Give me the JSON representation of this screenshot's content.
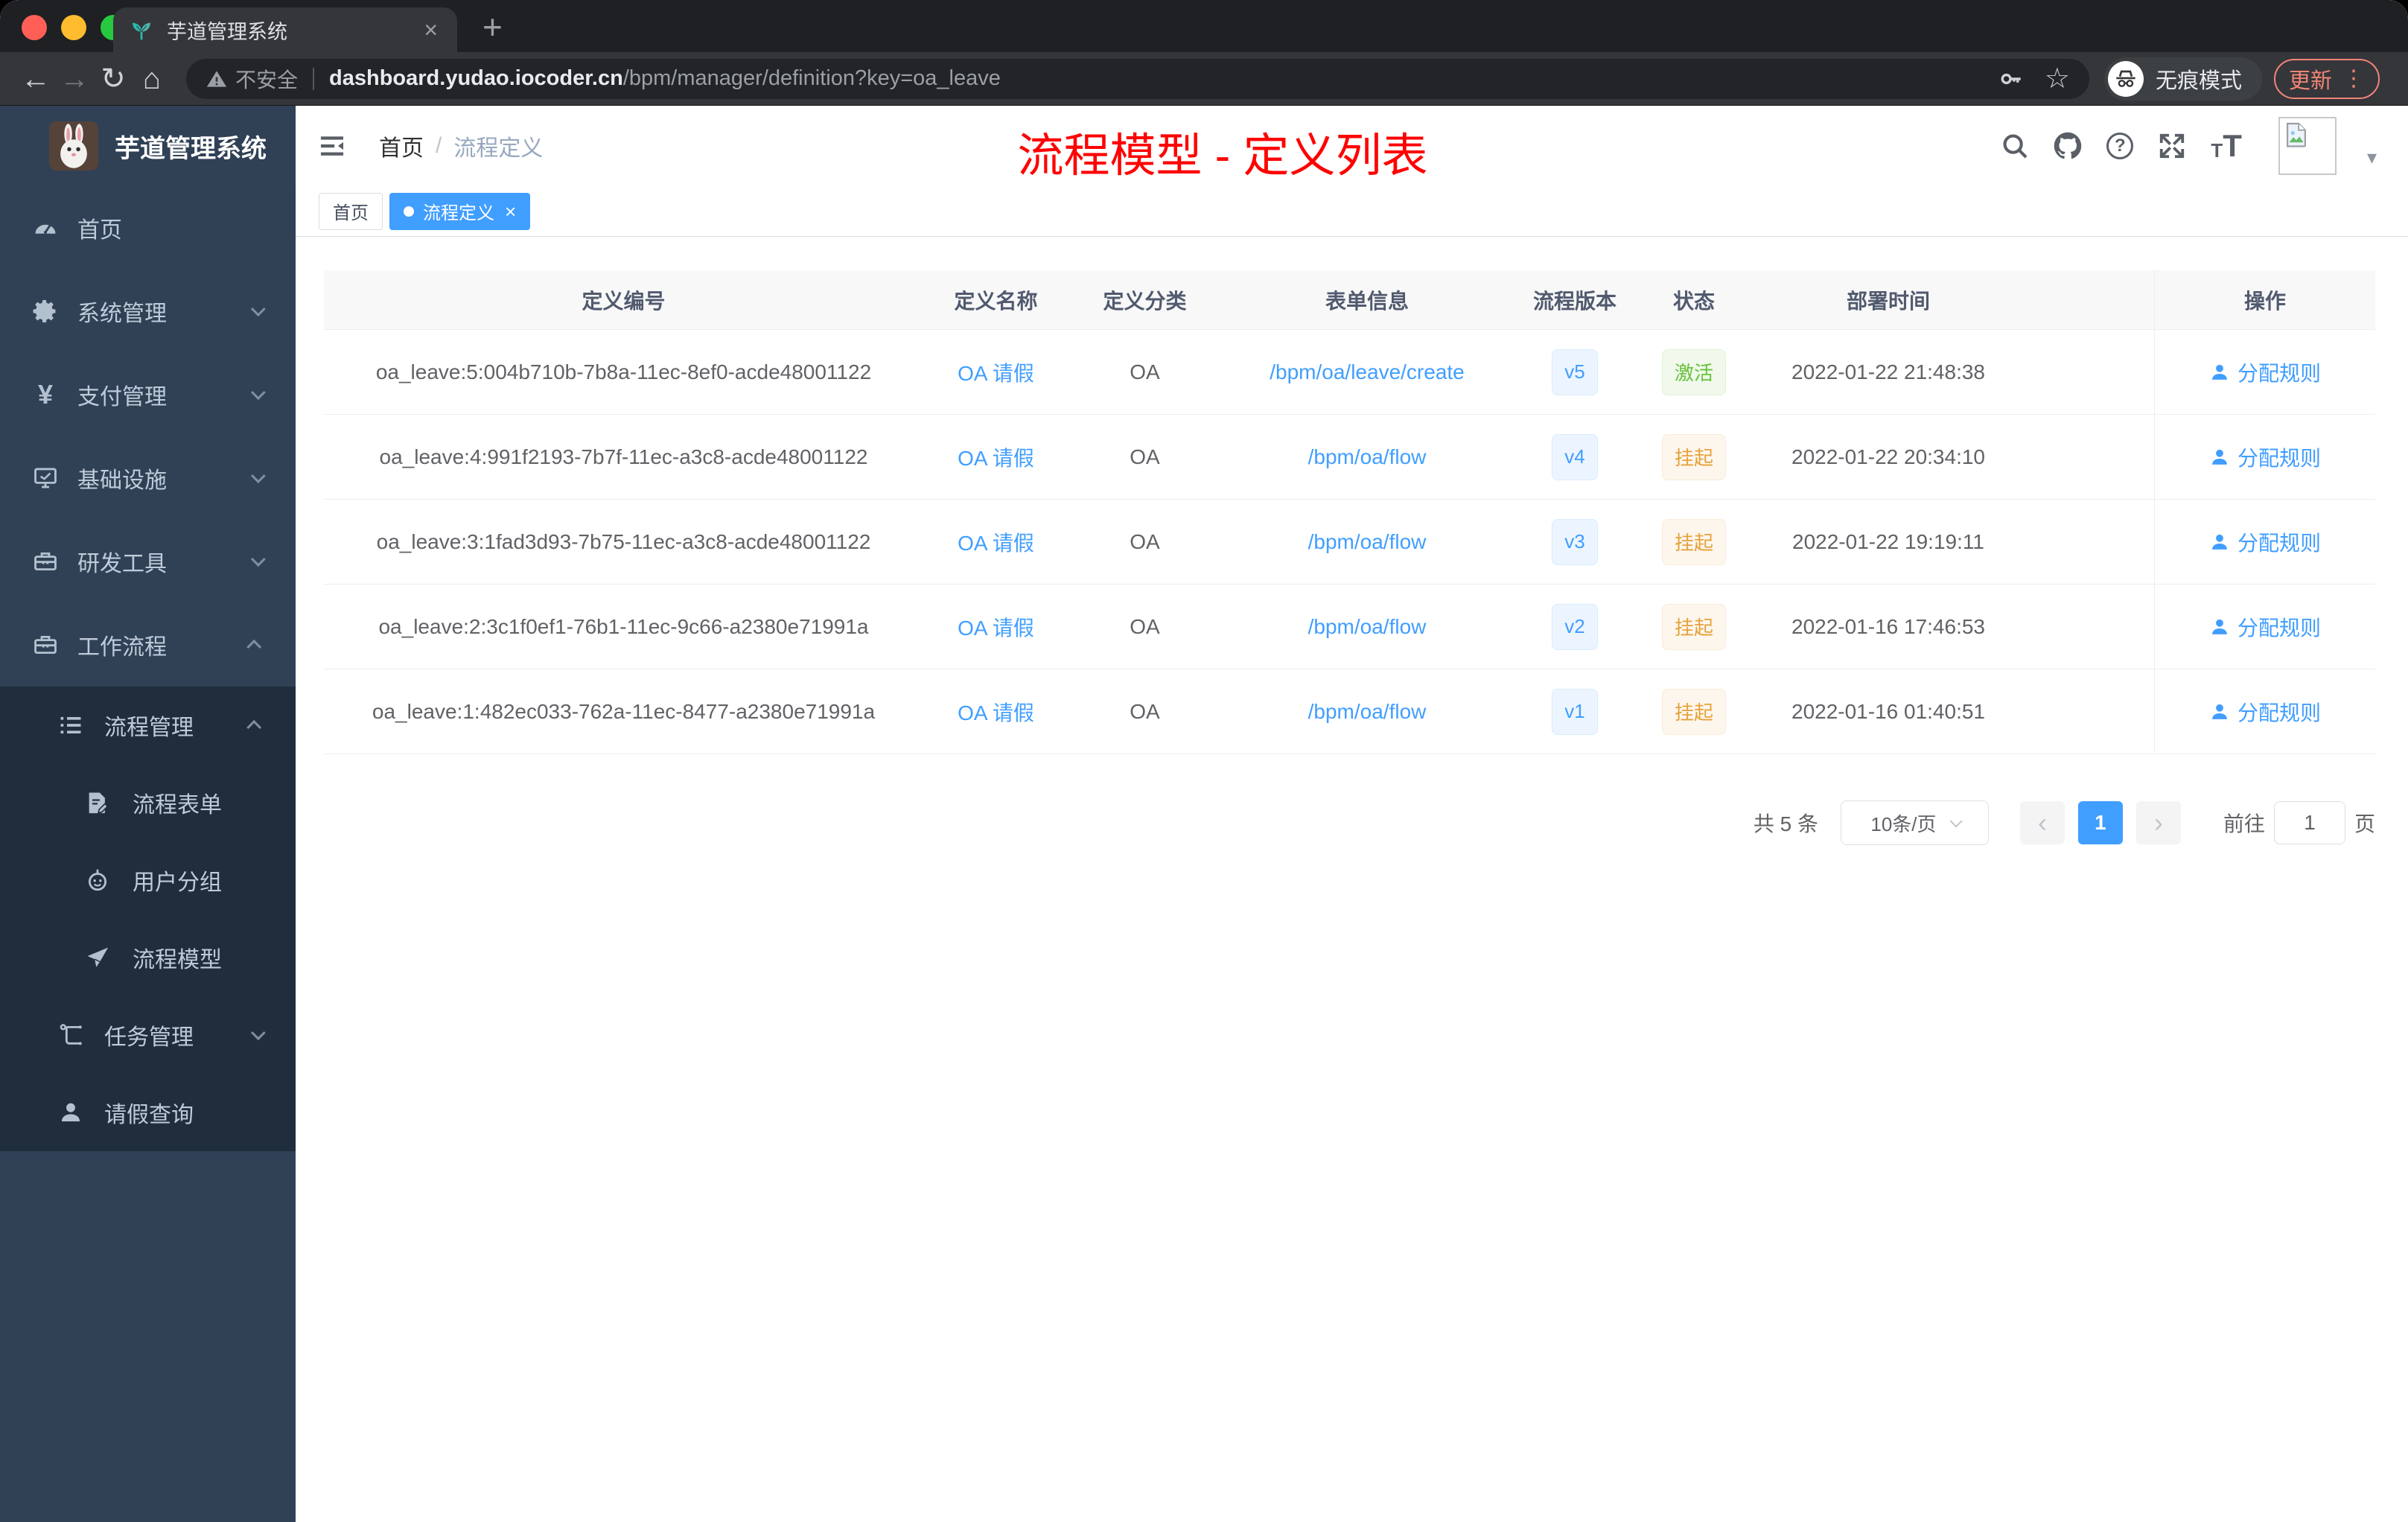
{
  "browser": {
    "tab_title": "芋道管理系统",
    "tab_close": "×",
    "new_tab": "+",
    "back": "←",
    "forward": "→",
    "reload": "↻",
    "home": "⌂",
    "security_label": "不安全",
    "url_host": "dashboard.yudao.iocoder.cn",
    "url_path": "/bpm/manager/definition?key=oa_leave",
    "star": "☆",
    "incognito_label": "无痕模式",
    "update_label": "更新",
    "menu_dots": "⋮"
  },
  "sidebar": {
    "logo_title": "芋道管理系统",
    "items": {
      "home": "首页",
      "system": "系统管理",
      "payment": "支付管理",
      "infra": "基础设施",
      "devtools": "研发工具",
      "workflow": "工作流程",
      "process_mgmt": "流程管理",
      "process_form": "流程表单",
      "user_group": "用户分组",
      "process_model": "流程模型",
      "task_mgmt": "任务管理",
      "leave_query": "请假查询"
    },
    "yen_glyph": "¥"
  },
  "navbar": {
    "breadcrumb_home": "首页",
    "breadcrumb_sep": "/",
    "breadcrumb_current": "流程定义",
    "annotation": "流程模型 - 定义列表",
    "help_glyph": "?",
    "text_size_small": "T",
    "text_size_large": "T",
    "avatar_caret": "▾"
  },
  "tags": {
    "home": "首页",
    "active": "流程定义",
    "close": "×"
  },
  "table": {
    "columns": {
      "id": "定义编号",
      "name": "定义名称",
      "category": "定义分类",
      "form": "表单信息",
      "version": "流程版本",
      "status": "状态",
      "time": "部署时间",
      "action": "操作"
    },
    "rows": [
      {
        "id": "oa_leave:5:004b710b-7b8a-11ec-8ef0-acde48001122",
        "name": "OA 请假",
        "category": "OA",
        "form": "/bpm/oa/leave/create",
        "version": "v5",
        "status": "激活",
        "time": "2022-01-22 21:48:38",
        "action": "分配规则"
      },
      {
        "id": "oa_leave:4:991f2193-7b7f-11ec-a3c8-acde48001122",
        "name": "OA 请假",
        "category": "OA",
        "form": "/bpm/oa/flow",
        "version": "v4",
        "status": "挂起",
        "time": "2022-01-22 20:34:10",
        "action": "分配规则"
      },
      {
        "id": "oa_leave:3:1fad3d93-7b75-11ec-a3c8-acde48001122",
        "name": "OA 请假",
        "category": "OA",
        "form": "/bpm/oa/flow",
        "version": "v3",
        "status": "挂起",
        "time": "2022-01-22 19:19:11",
        "action": "分配规则"
      },
      {
        "id": "oa_leave:2:3c1f0ef1-76b1-11ec-9c66-a2380e71991a",
        "name": "OA 请假",
        "category": "OA",
        "form": "/bpm/oa/flow",
        "version": "v2",
        "status": "挂起",
        "time": "2022-01-16 17:46:53",
        "action": "分配规则"
      },
      {
        "id": "oa_leave:1:482ec033-762a-11ec-8477-a2380e71991a",
        "name": "OA 请假",
        "category": "OA",
        "form": "/bpm/oa/flow",
        "version": "v1",
        "status": "挂起",
        "time": "2022-01-16 01:40:51",
        "action": "分配规则"
      }
    ]
  },
  "pagination": {
    "total": "共 5 条",
    "page_size": "10条/页",
    "prev": "‹",
    "page": "1",
    "next": "›",
    "goto_label": "前往",
    "goto_value": "1",
    "page_unit": "页"
  },
  "icons": {
    "favicon": "seedling-icon",
    "security": "warning-icon",
    "bookmark": "star-icon",
    "credentials": "key-icon",
    "incognito": "incognito-icon",
    "sidebar_home": "dashboard-icon",
    "sidebar_system": "gear-icon",
    "sidebar_payment": "yen-icon",
    "sidebar_infra": "monitor-icon",
    "sidebar_devtools": "toolbox-icon",
    "sidebar_workflow": "briefcase-icon",
    "sidebar_process_mgmt": "list-icon",
    "sidebar_process_form": "form-edit-icon",
    "sidebar_user_group": "robot-icon",
    "sidebar_process_model": "paper-plane-icon",
    "sidebar_task_mgmt": "tree-icon",
    "sidebar_leave_query": "user-icon",
    "navbar_right": [
      "search-icon",
      "github-icon",
      "help-icon",
      "fullscreen-icon",
      "text-size-icon"
    ],
    "action": "assign-user-icon",
    "avatar": "broken-image-icon"
  },
  "colors": {
    "accent": "#409eff",
    "success": "#67c23a",
    "warning": "#e6a23c",
    "annotation_red": "#ff0000",
    "sidebar_bg": "#304156",
    "submenu_bg": "#1f2d3d",
    "table_header_bg": "#f8f8f9",
    "chrome_dark": "#35363a",
    "update_red": "#f08577"
  }
}
